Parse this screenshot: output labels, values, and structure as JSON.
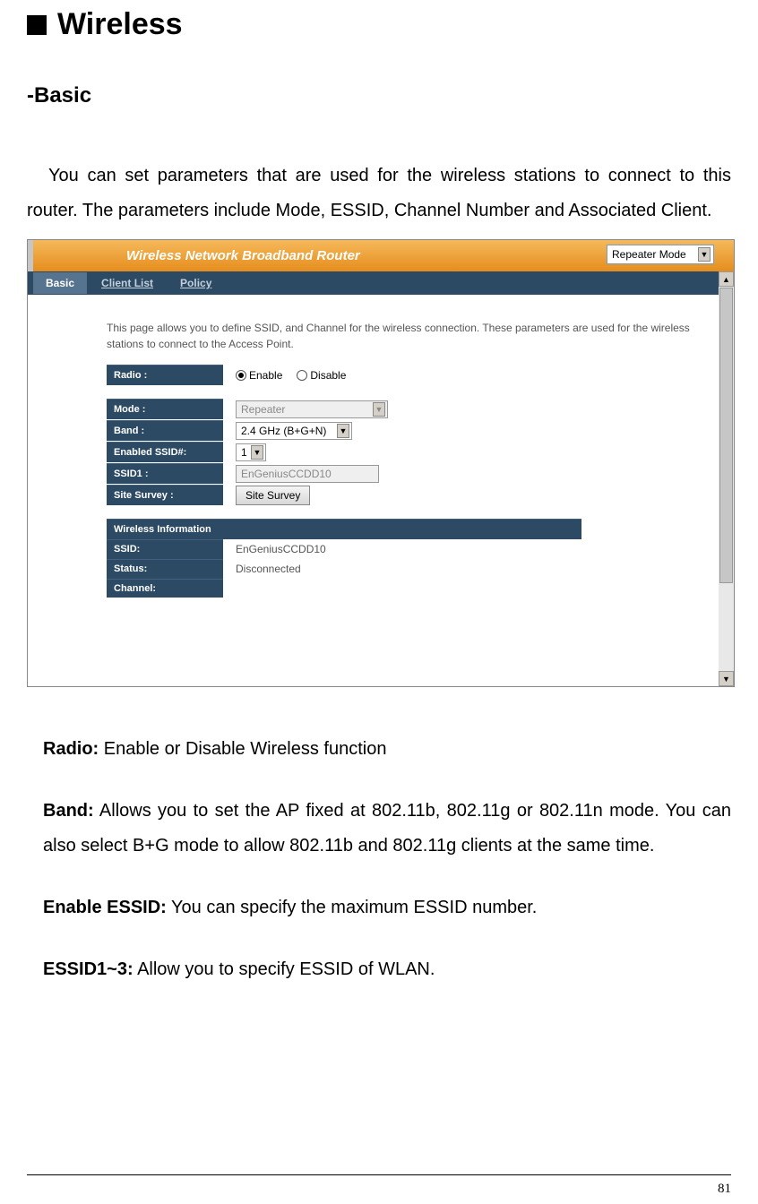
{
  "page": {
    "section_title": "Wireless",
    "subsection_title": "-Basic",
    "intro": "You can set parameters that are used for the wireless stations to connect to this router. The parameters include Mode, ESSID, Channel Number and Associated Client.",
    "page_number": "81"
  },
  "screenshot": {
    "titlebar": "Wireless Network Broadband Router",
    "mode_dropdown": "Repeater Mode",
    "tabs": {
      "basic": "Basic",
      "clientlist": "Client List",
      "policy": "Policy"
    },
    "help_text": "This page allows you to define SSID, and Channel for the wireless connection. These parameters are used for the wireless stations to connect to the Access Point.",
    "fields": {
      "radio_label": "Radio :",
      "radio_enable": "Enable",
      "radio_disable": "Disable",
      "mode_label": "Mode :",
      "mode_value": "Repeater",
      "band_label": "Band :",
      "band_value": "2.4 GHz (B+G+N)",
      "enabled_ssid_label": "Enabled SSID#:",
      "enabled_ssid_value": "1",
      "ssid1_label": "SSID1 :",
      "ssid1_value": "EnGeniusCCDD10",
      "survey_label": "Site Survey :",
      "survey_button": "Site Survey"
    },
    "info": {
      "header": "Wireless Information",
      "ssid_label": "SSID:",
      "ssid_value": "EnGeniusCCDD10",
      "status_label": "Status:",
      "status_value": "Disconnected",
      "channel_label": "Channel:"
    }
  },
  "definitions": {
    "radio_label": "Radio:",
    "radio_text": " Enable or Disable Wireless function",
    "band_label": "Band:",
    "band_text": " Allows you to set the AP fixed at 802.11b, 802.11g or 802.11n mode. You can also select B+G mode to allow 802.11b and 802.11g clients at the same time.",
    "enable_essid_label": "Enable ESSID:",
    "enable_essid_text": " You can specify the maximum ESSID number.",
    "essid13_label": "ESSID1~3:",
    "essid13_text": " Allow you to specify ESSID of WLAN."
  }
}
